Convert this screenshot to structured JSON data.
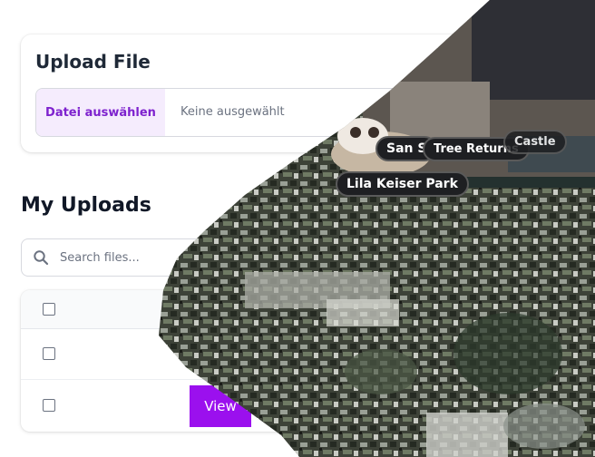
{
  "upload": {
    "title": "Upload File",
    "button_label": "Datei auswählen",
    "status": "Keine ausgewählt"
  },
  "uploads": {
    "title": "My Uploads",
    "search_placeholder": "Search files...",
    "rows": [
      {
        "action": ""
      },
      {
        "action": "View"
      }
    ]
  },
  "map_labels": [
    "San S",
    "Tree Returns",
    "Castle",
    "Lila Keiser Park"
  ],
  "colors": {
    "accent": "#9b10ee",
    "accent_text": "#7e22ce",
    "accent_light": "#f5ecfd"
  }
}
